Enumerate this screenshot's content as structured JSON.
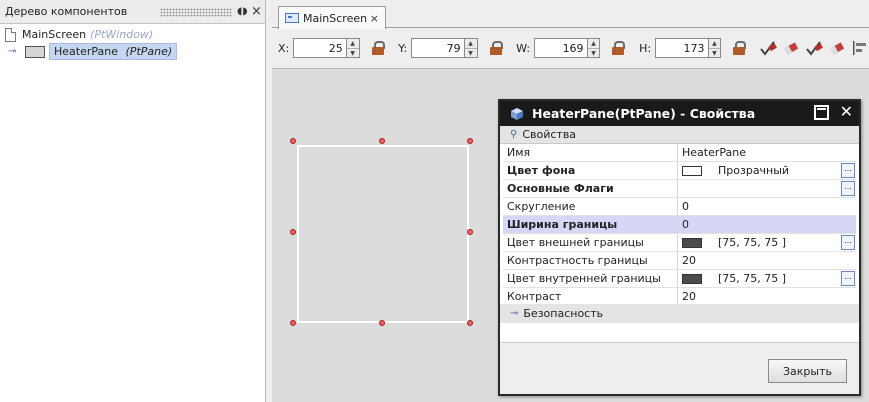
{
  "tree_panel": {
    "title": "Дерево компонентов",
    "items": [
      {
        "name": "MainScreen",
        "type": "(PtWindow)"
      },
      {
        "name": "HeaterPane",
        "type": "(PtPane)",
        "selected": true
      }
    ]
  },
  "editor": {
    "tab_label": "MainScreen",
    "toolbar": {
      "x_label": "X:",
      "x_value": "25",
      "y_label": "Y:",
      "y_value": "79",
      "w_label": "W:",
      "w_value": "169",
      "h_label": "H:",
      "h_value": "173"
    }
  },
  "props_dialog": {
    "title": "HeaterPane(PtPane) - Свойства",
    "section_main": "Свойства",
    "rows": [
      {
        "name": "Имя",
        "value": "HeaterPane",
        "bold": false
      },
      {
        "name": "Цвет фона",
        "value": "Прозрачный",
        "bold": true,
        "color": "#ffffff"
      },
      {
        "name": "Основные Флаги",
        "value": "",
        "bold": true
      },
      {
        "name": "Скругление",
        "value": "0",
        "bold": false
      },
      {
        "name": "Ширина границы",
        "value": "0",
        "bold": true,
        "highlight": true
      },
      {
        "name": "Цвет внешней границы",
        "value": "[75, 75, 75 ]",
        "bold": false,
        "color": "#4b4b4b"
      },
      {
        "name": "Контрастность границы",
        "value": "20",
        "bold": false
      },
      {
        "name": "Цвет внутренней границы",
        "value": "[75, 75, 75 ]",
        "bold": false,
        "color": "#4b4b4b"
      },
      {
        "name": "Контраст",
        "value": "20",
        "bold": false
      }
    ],
    "section_security": "Безопасность",
    "close_button": "Закрыть"
  },
  "icons": {
    "tree_minimize": "◖◗",
    "tree_close": "×",
    "tab_close": "×",
    "spin_up": "▲",
    "spin_down": "▼",
    "ellipsis": "...",
    "dialog_close": "✕",
    "section_collapse": "⚲",
    "section_expand": "⊸"
  }
}
